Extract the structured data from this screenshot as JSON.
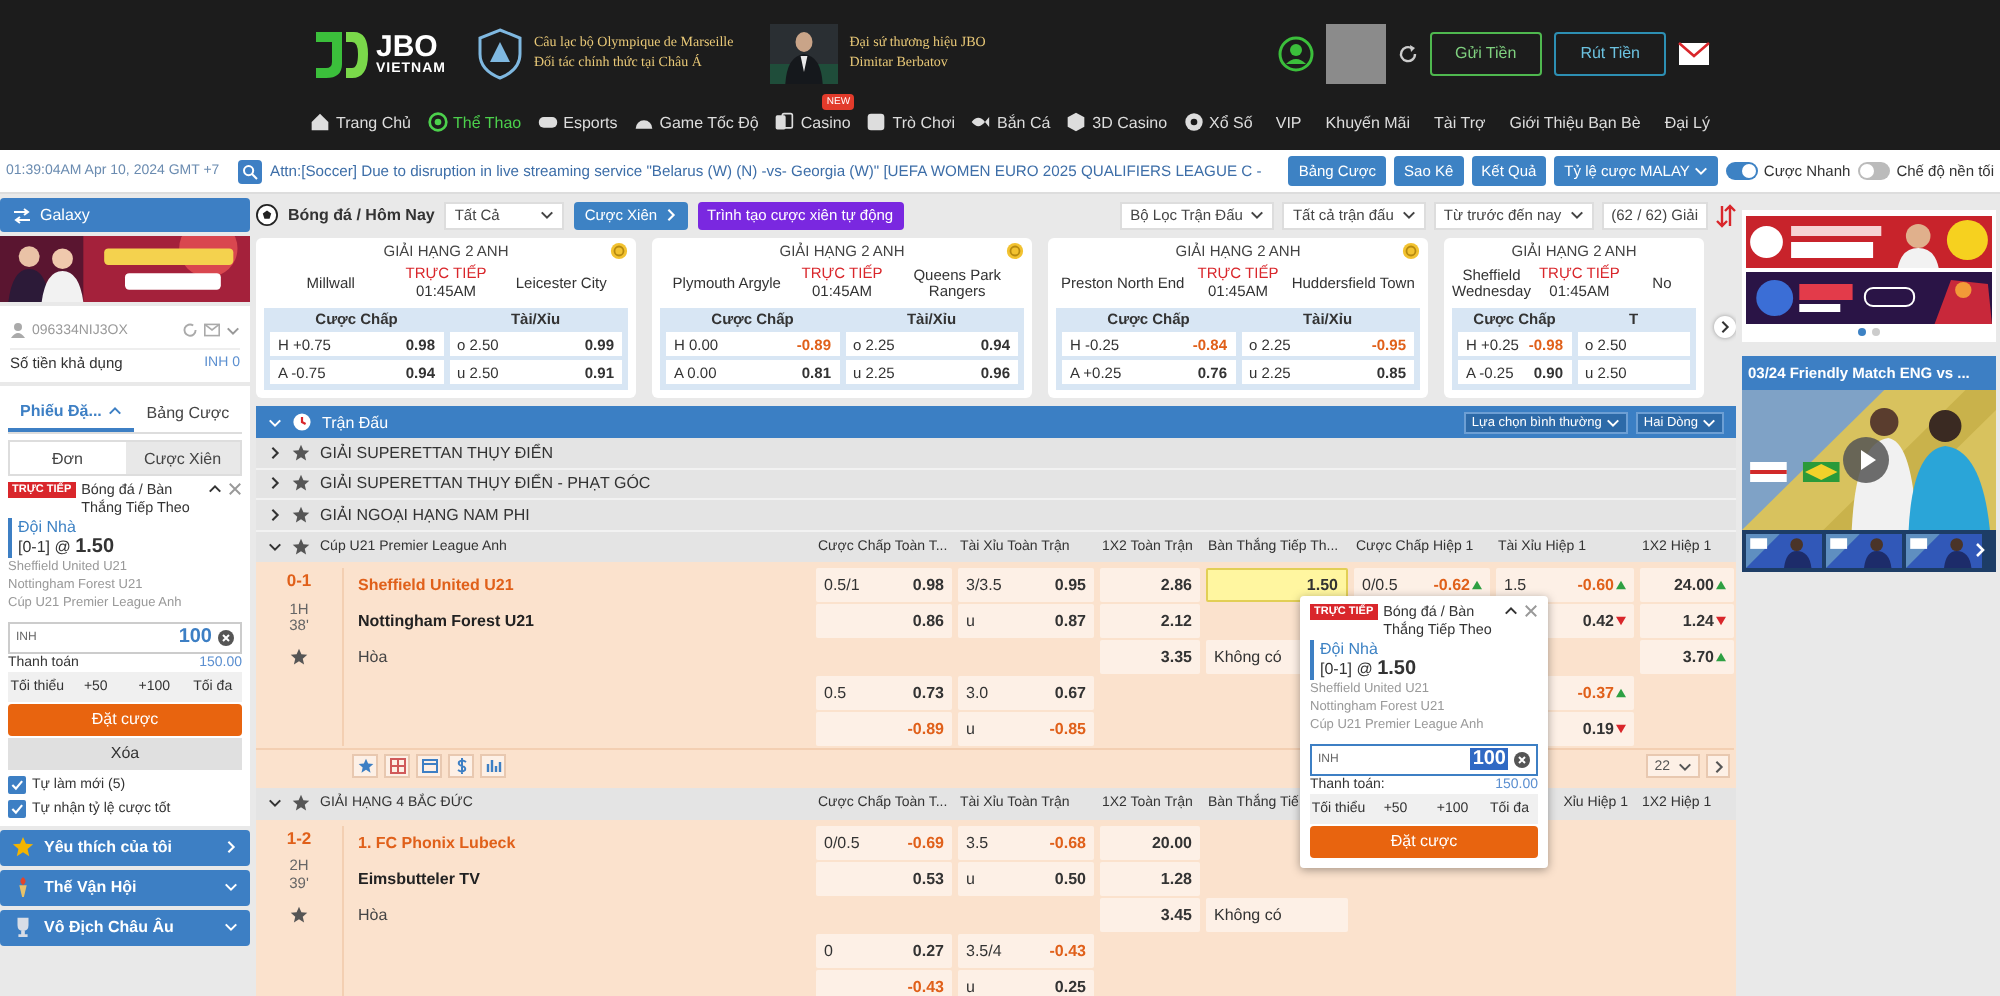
{
  "header": {
    "logo": {
      "brand": "JBO",
      "sub": "VIETNAM"
    },
    "partner": [
      "Câu lạc bộ Olympique de Marseille",
      "Đối tác chính thức tại Châu Á"
    ],
    "ambassador": [
      "Đại sứ thương hiệu JBO",
      "Dimitar Berbatov"
    ],
    "buttons": [
      "Gửi Tiền",
      "Rút Tiền"
    ],
    "nav": [
      {
        "label": "Trang Chủ",
        "selected": false
      },
      {
        "label": "Thể Thao",
        "selected": true
      },
      {
        "label": "Esports",
        "selected": false
      },
      {
        "label": "Game Tốc Độ",
        "selected": false
      },
      {
        "label": "Casino",
        "selected": false,
        "badge": "NEW"
      },
      {
        "label": "Trò Chơi",
        "selected": false
      },
      {
        "label": "Bắn Cá",
        "selected": false
      },
      {
        "label": "3D Casino",
        "selected": false
      },
      {
        "label": "Xổ Số",
        "selected": false
      }
    ],
    "nav_right": [
      "VIP",
      "Khuyến Mãi",
      "Tài Trợ",
      "Giới Thiệu Bạn Bè",
      "Đại Lý"
    ]
  },
  "topbar": {
    "time": "01:39:04AM Apr 10, 2024 GMT +7",
    "ticker": "Attn:[Soccer] Due to disruption in live streaming service \"Belarus (W) (N) -vs- Georgia (W)\" [UEFA WOMEN EURO 2025 QUALIFIERS LEAGUE C -",
    "buttons": [
      "Bảng Cược",
      "Sao Kê",
      "Kết Quả"
    ],
    "odds_type": "Tỷ lệ cược MALAY",
    "toggles": [
      {
        "label": "Cược Nhanh",
        "on": true
      },
      {
        "label": "Chế độ nền tối",
        "on": false
      }
    ]
  },
  "sidebar": {
    "wallet": "Galaxy",
    "account": "096334NIJ3OX",
    "balance_label": "Số tiền khả dụng",
    "balance": "INH 0",
    "tabs": [
      {
        "label": "Phiếu Đặ...",
        "selected": true
      },
      {
        "label": "Bảng Cược",
        "selected": false
      }
    ],
    "modes": [
      {
        "label": "Đơn",
        "selected": true
      },
      {
        "label": "Cược Xiên",
        "selected": false
      }
    ],
    "slip": {
      "live": "TRỰC TIẾP",
      "market": "Bóng đá / Bàn Thắng Tiếp Theo",
      "pick": "Đội Nhà",
      "pick_line": "[0-1] @ **1.50**",
      "details": [
        "Sheffield United U21",
        "Nottingham Forest U21",
        "Cúp U21 Premier League Anh"
      ],
      "currency": "INH",
      "stake": "100",
      "payout_label": "Thanh toán",
      "payout": "150.00",
      "quick": [
        "Tối thiểu",
        "+50",
        "+100",
        "Tối đa"
      ],
      "submit": "Đặt cược",
      "clear": "Xóa"
    },
    "options": [
      {
        "label": "Tự làm mới (5)",
        "checked": true
      },
      {
        "label": "Tự nhận tỷ lệ cược tốt",
        "checked": true
      }
    ],
    "sections": [
      {
        "label": "Yêu thích của tôi",
        "kind": "link"
      },
      {
        "label": "Thế Vận Hội",
        "kind": "menu"
      },
      {
        "label": "Vô Địch Châu Âu",
        "kind": "menu"
      }
    ]
  },
  "filter": {
    "sport": "Bóng đá / Hôm Nay",
    "select": "Tất Cả",
    "parlay": "Cược Xiên",
    "builder": "Trình tạo cược xiên tự động",
    "dropdowns": [
      "Bộ Lọc Trận Đấu",
      "Tất cả trận đấu",
      "Từ trước đến nay"
    ],
    "count": "(62 / 62) Giải"
  },
  "cards": [
    {
      "league": "GIẢI HẠNG 2 ANH",
      "status": "TRỰC TIẾP",
      "time": "01:45AM",
      "home": "Millwall",
      "away": "Leicester City",
      "hdp_label": "Cược Chấp",
      "ou_label": "Tài/Xỉu",
      "rows": [
        {
          "hdp": "H +0.75",
          "hdp_odds": "0.98",
          "ou": "o 2.50",
          "ou_odds": "0.99"
        },
        {
          "hdp": "A -0.75",
          "hdp_odds": "0.94",
          "ou": "u 2.50",
          "ou_odds": "0.91"
        }
      ]
    },
    {
      "league": "GIẢI HẠNG 2 ANH",
      "status": "TRỰC TIẾP",
      "time": "01:45AM",
      "home": "Plymouth Argyle",
      "away": "Queens Park Rangers",
      "hdp_label": "Cược Chấp",
      "ou_label": "Tài/Xỉu",
      "rows": [
        {
          "hdp": "H 0.00",
          "hdp_odds": "-0.89",
          "hdp_neg": true,
          "ou": "o 2.25",
          "ou_odds": "0.94"
        },
        {
          "hdp": "A 0.00",
          "hdp_odds": "0.81",
          "ou": "u 2.25",
          "ou_odds": "0.96"
        }
      ]
    },
    {
      "league": "GIẢI HẠNG 2 ANH",
      "status": "TRỰC TIẾP",
      "time": "01:45AM",
      "home": "Preston North End",
      "away": "Huddersfield Town",
      "hdp_label": "Cược Chấp",
      "ou_label": "Tài/Xỉu",
      "rows": [
        {
          "hdp": "H -0.25",
          "hdp_odds": "-0.84",
          "hdp_neg": true,
          "ou": "o 2.25",
          "ou_odds": "-0.95",
          "ou_neg": true
        },
        {
          "hdp": "A +0.25",
          "hdp_odds": "0.76",
          "ou": "u 2.25",
          "ou_odds": "0.85"
        }
      ]
    },
    {
      "league": "GIẢI HẠNG 2 ANH",
      "status": "TRỰC TIẾP",
      "time": "01:45AM",
      "home": "Sheffield Wednesday",
      "away": "No",
      "hdp_label": "Cược Chấp",
      "ou_label": "T",
      "rows": [
        {
          "hdp": "H +0.25",
          "hdp_odds": "-0.98",
          "hdp_neg": true,
          "ou": "o 2.50"
        },
        {
          "hdp": "A -0.25",
          "hdp_odds": "0.90",
          "ou": "u 2.50"
        }
      ]
    }
  ],
  "table": {
    "title": "Trận Đấu",
    "view": "Lựa chọn bình thường",
    "lines": "Hai Dòng",
    "collapsed": [
      "GIẢI SUPERETTAN THỤY ĐIỂN",
      "GIẢI SUPERETTAN THỤY ĐIỂN - PHẠT GÓC",
      "GIẢI NGOẠI HẠNG NAM PHI"
    ],
    "leagues": [
      {
        "name": "Cúp U21 Premier League Anh",
        "columns": [
          "Cược Chấp Toàn T...",
          "Tài Xỉu Toàn Trận",
          "1X2 Toàn Trận",
          "Bàn Thắng Tiếp Th...",
          "Cược Chấp Hiệp 1",
          "Tài Xỉu Hiệp 1",
          "1X2 Hiệp 1"
        ],
        "matches": [
          {
            "score": "0-1",
            "period": "1H",
            "minute": "38'",
            "page": "22",
            "teams": [
              {
                "name": "Sheffield United U21",
                "favorite": true
              },
              {
                "name": "Nottingham Forest U21",
                "favorite": false
              },
              {
                "name": "Hòa",
                "favorite": false
              }
            ],
            "rows": [
              [
                {
                  "line": "0.5/1",
                  "odds": "0.98"
                },
                {
                  "line": "3/3.5",
                  "odds": "0.95"
                },
                {
                  "odds": "2.86"
                },
                {
                  "odds": "1.50",
                  "highlight": true
                },
                {
                  "line": "0/0.5",
                  "odds": "-0.62",
                  "neg": true,
                  "rising": true
                },
                {
                  "line": "1.5",
                  "odds": "-0.60",
                  "neg": true,
                  "rising": true
                },
                {
                  "odds": "24.00",
                  "rising": true
                }
              ],
              [
                {
                  "odds": "0.86"
                },
                {
                  "line": "u",
                  "odds": "0.87"
                },
                {
                  "odds": "2.12"
                },
                null,
                null,
                {
                  "odds": "0.42",
                  "rising": false
                },
                {
                  "odds": "1.24",
                  "rising": false
                }
              ],
              [
                null,
                null,
                {
                  "odds": "3.35"
                },
                {
                  "line": "Không có"
                },
                null,
                null,
                {
                  "odds": "3.70",
                  "rising": true
                }
              ],
              [
                {
                  "line": "0.5",
                  "odds": "0.73"
                },
                {
                  "line": "3.0",
                  "odds": "0.67"
                },
                null,
                null,
                null,
                {
                  "odds": "-0.37",
                  "neg": true,
                  "rising": true
                },
                null
              ],
              [
                {
                  "odds": "-0.89",
                  "neg": true
                },
                {
                  "line": "u",
                  "odds": "-0.85",
                  "neg": true
                },
                null,
                null,
                null,
                {
                  "odds": "0.19",
                  "rising": false
                },
                null
              ]
            ]
          }
        ]
      },
      {
        "name": "GIẢI HẠNG 4 BẮC ĐỨC",
        "columns": [
          "Cược Chấp Toàn T...",
          "Tài Xỉu Toàn Trận",
          "1X2 Toàn Trận",
          "Bàn Thắng Tiế",
          null,
          "Xỉu Hiệp 1",
          "1X2 Hiệp 1"
        ],
        "matches": [
          {
            "score": "1-2",
            "period": "2H",
            "minute": "39'",
            "teams": [
              {
                "name": "1. FC Phonix Lubeck",
                "favorite": true
              },
              {
                "name": "Eimsbutteler TV",
                "favorite": false
              },
              {
                "name": "Hòa",
                "favorite": false
              }
            ],
            "rows": [
              [
                {
                  "line": "0/0.5",
                  "odds": "-0.69",
                  "neg": true
                },
                {
                  "line": "3.5",
                  "odds": "-0.68",
                  "neg": true
                },
                {
                  "odds": "20.00"
                },
                null,
                null,
                null,
                null
              ],
              [
                {
                  "odds": "0.53"
                },
                {
                  "line": "u",
                  "odds": "0.50"
                },
                {
                  "odds": "1.28"
                },
                null,
                null,
                null,
                null
              ],
              [
                null,
                null,
                {
                  "odds": "3.45"
                },
                {
                  "line": "Không có"
                },
                null,
                null,
                null
              ],
              [
                {
                  "line": "0",
                  "odds": "0.27"
                },
                {
                  "line": "3.5/4",
                  "odds": "-0.43",
                  "neg": true
                },
                null,
                null,
                null,
                null,
                null
              ],
              [
                {
                  "odds": "-0.43",
                  "neg": true
                },
                {
                  "line": "u",
                  "odds": "0.25"
                },
                null,
                null,
                null,
                null,
                null
              ]
            ]
          }
        ]
      }
    ],
    "popup": {
      "live": "TRỰC TIẾP",
      "market": "Bóng đá / Bàn Thắng Tiếp Theo",
      "pick": "Đội Nhà",
      "pick_line": "[0-1] @ **1.50**",
      "details": [
        "Sheffield United U21",
        "Nottingham Forest U21",
        "Cúp U21 Premier League Anh"
      ],
      "currency": "INH",
      "stake": "100",
      "payout_label": "Thanh toán:",
      "payout": "150.00",
      "quick": [
        "Tối thiểu",
        "+50",
        "+100",
        "Tối đa"
      ],
      "submit": "Đặt cược"
    }
  },
  "right": {
    "slides": [
      {
        "selected": true
      },
      {
        "selected": false
      }
    ],
    "video_title": "03/24 Friendly Match ENG vs ..."
  }
}
